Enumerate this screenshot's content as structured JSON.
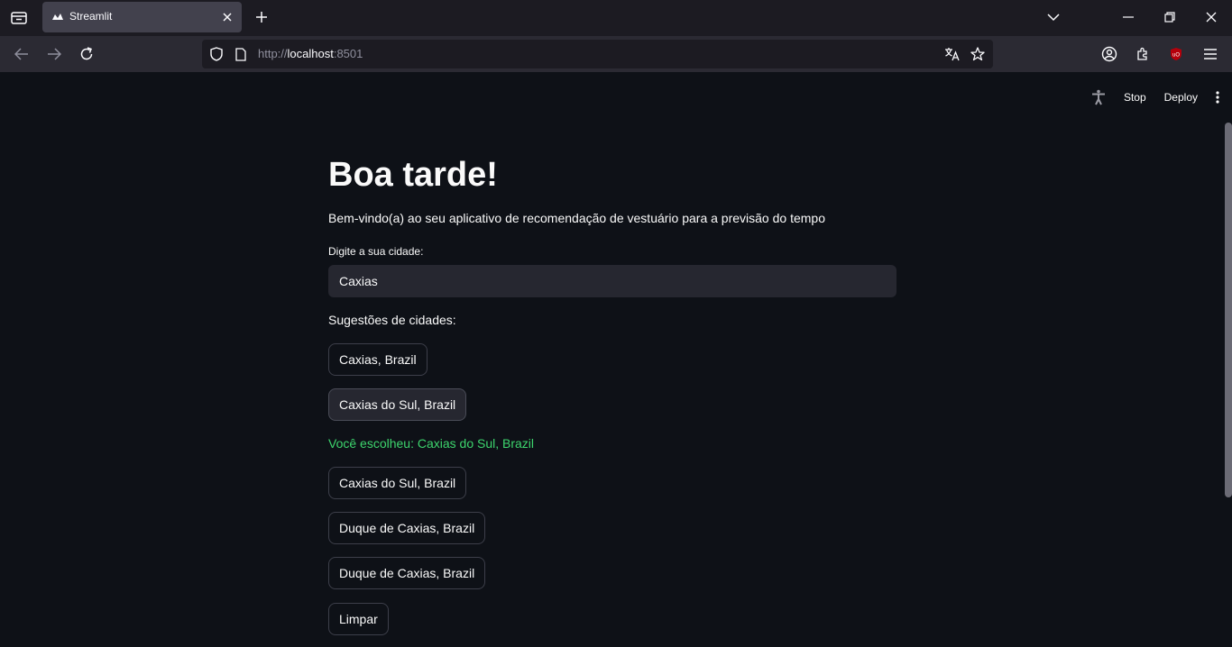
{
  "browser": {
    "tab_title": "Streamlit",
    "url_prefix": "http://",
    "url_host": "localhost",
    "url_suffix": ":8501"
  },
  "toolbar": {
    "stop_label": "Stop",
    "deploy_label": "Deploy"
  },
  "app": {
    "title": "Boa tarde!",
    "subtitle": "Bem-vindo(a) ao seu aplicativo de recomendação de vestuário para a previsão do tempo",
    "city_input_label": "Digite a sua cidade:",
    "city_input_value": "Caxias",
    "suggestions_label": "Sugestões de cidades:",
    "suggestions_first": [
      "Caxias, Brazil",
      "Caxias do Sul, Brazil"
    ],
    "chosen_text": "Você escolheu: Caxias do Sul, Brazil",
    "suggestions_second": [
      "Caxias do Sul, Brazil",
      "Duque de Caxias, Brazil",
      "Duque de Caxias, Brazil"
    ],
    "clear_label": "Limpar"
  },
  "colors": {
    "background": "#0e1117",
    "success_text": "#3dd56d",
    "input_bg": "#262730"
  }
}
